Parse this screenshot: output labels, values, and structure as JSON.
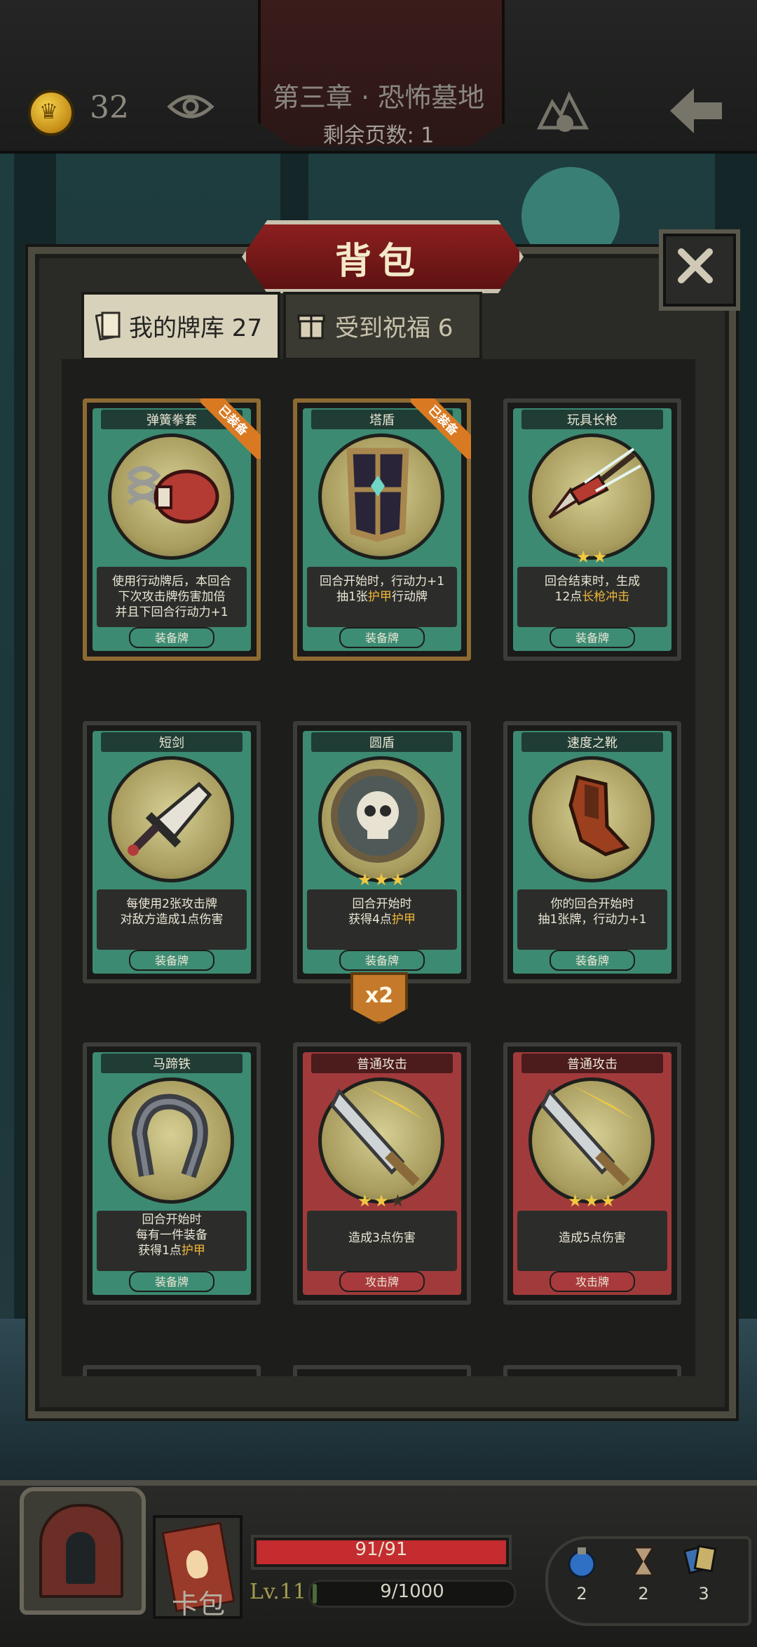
{
  "hud": {
    "coins": "32",
    "chapter_title": "第三章 · 恐怖墓地",
    "pages_left": "剩余页数: 1"
  },
  "panel": {
    "title": "背包",
    "tabs": [
      {
        "label": "我的牌库 27",
        "active": true,
        "icon": "card-deck-icon"
      },
      {
        "label": "受到祝福 6",
        "active": false,
        "icon": "gift-icon"
      }
    ]
  },
  "cards": [
    {
      "name": "弹簧拳套",
      "equipped_label": "已装备",
      "desc_lines": [
        "使用行动牌后，本回合",
        "下次攻击牌伤害加倍",
        "并且下回合行动力+1"
      ],
      "type": "装备牌",
      "stars": 0
    },
    {
      "name": "塔盾",
      "equipped_label": "已装备",
      "desc_pre": "回合开始时，行动力+1",
      "desc_line2_pre": "抽1张",
      "desc_hl": "护甲",
      "desc_line2_post": "行动牌",
      "type": "装备牌",
      "stars": 0
    },
    {
      "name": "玩具长枪",
      "desc_pre": "回合结束时，生成",
      "desc_line2_pre": "12点",
      "desc_hl": "长枪冲击",
      "desc_line2_post": "",
      "type": "装备牌",
      "stars": 2
    },
    {
      "name": "短剑",
      "desc_lines": [
        "每使用2张攻击牌",
        "对敌方造成1点伤害"
      ],
      "type": "装备牌",
      "stars": 0
    },
    {
      "name": "圆盾",
      "desc_pre": "回合开始时",
      "desc_line2_pre": "获得4点",
      "desc_hl": "护甲",
      "desc_line2_post": "",
      "type": "装备牌",
      "stars": 3,
      "count": "x2"
    },
    {
      "name": "速度之靴",
      "desc_lines": [
        "你的回合开始时",
        "抽1张牌，行动力+1"
      ],
      "type": "装备牌",
      "stars": 0
    },
    {
      "name": "马蹄铁",
      "desc_line1": "回合开始时",
      "desc_pre": "每有一件装备",
      "desc_line2_pre": "获得1点",
      "desc_hl": "护甲",
      "desc_line2_post": "",
      "type": "装备牌",
      "stars": 0
    },
    {
      "name": "普通攻击",
      "desc_lines": [
        "造成3点伤害"
      ],
      "type": "攻击牌",
      "stars": 2,
      "max_stars": 3
    },
    {
      "name": "普通攻击",
      "desc_lines": [
        "造成5点伤害"
      ],
      "type": "攻击牌",
      "stars": 3
    }
  ],
  "bottom": {
    "book_label": "卡包",
    "hp_text": "91/91",
    "hp_fraction": 1.0,
    "level": "Lv.11",
    "xp_text": "9/1000",
    "xp_fraction": 0.009,
    "resources": [
      {
        "icon": "potion-icon",
        "count": "2"
      },
      {
        "icon": "hourglass-icon",
        "count": "2"
      },
      {
        "icon": "cards-icon",
        "count": "3"
      }
    ]
  },
  "colors": {
    "equip_card": "#3c8a72",
    "attack_card": "#a13a3b",
    "highlight_text": "#f0b73a",
    "equipped_ribbon": "#d97a23",
    "hp_bar": "#c42c2f",
    "title_plate": "#8c1f1f"
  }
}
